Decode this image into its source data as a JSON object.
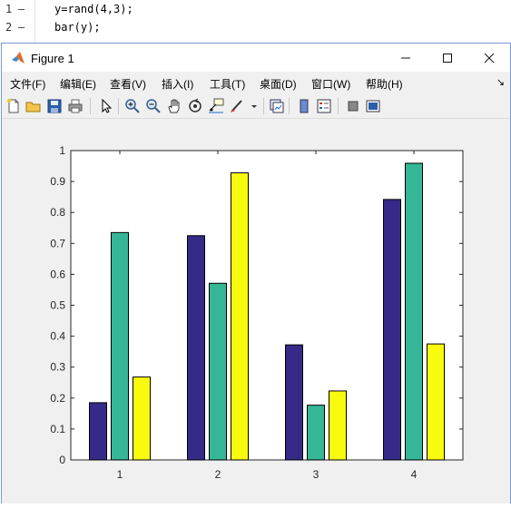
{
  "editor": {
    "lines": [
      {
        "num": "1",
        "dash": "–",
        "code": "y=rand(4,3);"
      },
      {
        "num": "2",
        "dash": "–",
        "code": "bar(y);"
      }
    ]
  },
  "window": {
    "title": "Figure 1",
    "controls": {
      "minimize": "—",
      "maximize": "☐",
      "close": "✕"
    }
  },
  "menu": {
    "items": [
      "文件(F)",
      "编辑(E)",
      "查看(V)",
      "插入(I)",
      "工具(T)",
      "桌面(D)",
      "窗口(W)",
      "帮助(H)"
    ],
    "corner": "↘"
  },
  "toolbar": {
    "icons": [
      "new-figure-icon",
      "open-file-icon",
      "save-icon",
      "print-icon",
      "edit-plot-arrow-icon",
      "zoom-in-icon",
      "zoom-out-icon",
      "pan-hand-icon",
      "rotate-3d-icon",
      "data-cursor-icon",
      "brush-icon",
      "brush-dropdown-icon",
      "link-plot-icon",
      "colorbar-icon",
      "legend-icon",
      "hide-plot-tools-icon",
      "show-plot-tools-icon"
    ]
  },
  "colors": {
    "series1": "#352a87",
    "series2": "#35b797",
    "series3": "#f9fb0e",
    "axes_bg": "#ffffff",
    "figure_bg": "#f0f0f0"
  },
  "chart_data": {
    "type": "bar",
    "categories": [
      "1",
      "2",
      "3",
      "4"
    ],
    "series": [
      {
        "values": [
          0.185,
          0.725,
          0.372,
          0.842
        ]
      },
      {
        "values": [
          0.735,
          0.571,
          0.177,
          0.959
        ]
      },
      {
        "values": [
          0.268,
          0.928,
          0.223,
          0.375
        ]
      }
    ],
    "ylim": [
      0,
      1
    ],
    "yticks": [
      "0",
      "0.1",
      "0.2",
      "0.3",
      "0.4",
      "0.5",
      "0.6",
      "0.7",
      "0.8",
      "0.9",
      "1"
    ],
    "xticks": [
      "1",
      "2",
      "3",
      "4"
    ],
    "grid": false,
    "legend": "none"
  }
}
